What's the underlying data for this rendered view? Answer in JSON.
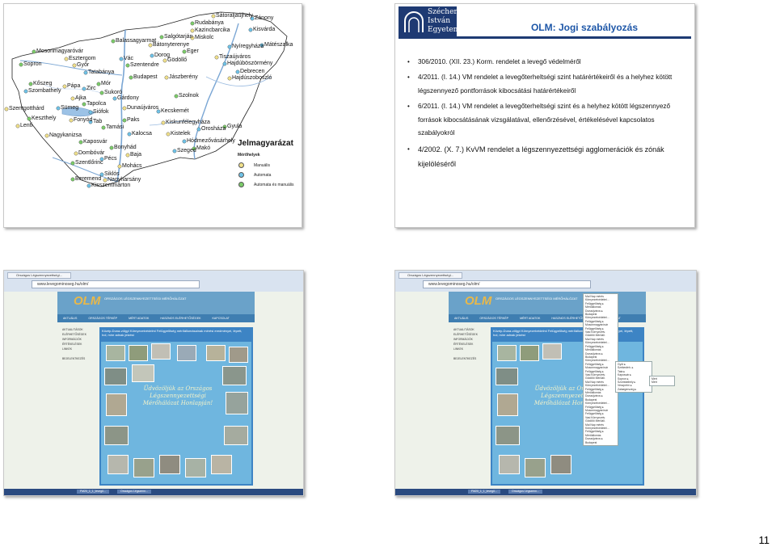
{
  "map_slide": {
    "legend_title": "Jelmagyarázat",
    "legend_subtitle": "Mérőhelyek",
    "legend": [
      {
        "label": "Manuális",
        "color": "#f0e08a"
      },
      {
        "label": "Automata",
        "color": "#6fc3e8"
      },
      {
        "label": "Automata és manuális",
        "color": "#7ccc6a"
      }
    ],
    "cities": [
      "Sátoraljaújhely",
      "Zánony",
      "Rudabánya",
      "Kazincbarcika",
      "Kisvárda",
      "Salgótarján",
      "Miskolc",
      "Mátészalka",
      "Balassagyarmat",
      "Bátonyterenye",
      "Nyíregyháza",
      "Mosonmagyaróvár",
      "Esztergom",
      "Vác",
      "Eger",
      "Tiszaújváros",
      "Dorog",
      "Szentendre",
      "Gödöllő",
      "Hajdúböszörmény",
      "Sopron",
      "Győr",
      "Tatabánya",
      "Budapest",
      "Jászberény",
      "Debrecen",
      "Kőszeg",
      "Pápa",
      "Zirc",
      "Mór",
      "Hajdúszoboszló",
      "Szombathely",
      "Sukoró",
      "Ajka",
      "Gárdony",
      "Szolnok",
      "Szentgotthárd",
      "Sümeg",
      "Tapolca",
      "Dunaújváros",
      "Kecskemét",
      "Keszthely",
      "Fonyód",
      "Siófok",
      "Paks",
      "Lenti",
      "Tab",
      "Tamási",
      "Kiskunfélegyháza",
      "Orosháza",
      "Gyula",
      "Nagykanizsa",
      "Kalocsa",
      "Kaposvár",
      "Kistelek",
      "Hódmezővásárhely",
      "Bonyhád",
      "Baja",
      "Szeged",
      "Makó",
      "Dombóvár",
      "Pécs",
      "Szentlőrinc",
      "Mohács",
      "Siklós",
      "Beremend",
      "Nagyharsány",
      "Kisszentmárton"
    ]
  },
  "text_slide": {
    "logo_lines": [
      "Széchenyi",
      "István",
      "Egyetem"
    ],
    "title": "OLM: Jogi szabályozás",
    "items": [
      "306/2010. (XII. 23.) Korm. rendelet a levegő védelméről",
      "4/2011. (I. 14.) VM rendelet a levegőterheltségi szint határértékeiről és a helyhez kötött légszennyező pontforrások kibocsátási határértékeiről",
      "6/2011. (I. 14.) VM rendelet a levegőterheltségi szint és a helyhez kötött légszennyező források kibocsátásának vizsgálatával, ellenőrzésével, értékelésével kapcsolatos szabályokról",
      "4/2002. (X. 7.) KvVM rendelet a légszennyezettségi agglomerációk és zónák kijelöléséről"
    ]
  },
  "browser": {
    "tab_label": "Országos Légszennyezettségi...",
    "url": "www.levegominoseg.hu/olm/",
    "site_logo": "OLM",
    "site_sub": "ORSZÁGOS LÉGSZENNYEZETTSÉGI MÉRŐHÁLÓZAT",
    "nav": [
      "AKTUÁLIS",
      "ORSZÁGOS TÉRKÉP",
      "MÉRT ADATOK",
      "HASZNOS ELÉRHETŐSÉGEK",
      "KAPCSOLAT"
    ],
    "side_menu": [
      "AKTUALITÁSOK",
      "ELÉRHETŐSÉGEK",
      "INFORMÁCIÓK",
      "ÉRTÉKELÉSEK",
      "LINKEK",
      "",
      "BEJELENTKEZÉS"
    ],
    "content_title": "Közép-Duna-völgyi Környezetvédelmi Felügyelőség mérőállomásainak mérési eredményei, lépett, hol, mire adnak jelzést",
    "welcome": "Üdvözöljük az Országos Légszennyezettségi Mérőhálózat Honlapján!",
    "taskbar": [
      "FM20_1_1_levegő...",
      "Országos Légszenn..."
    ],
    "dropdown": [
      "Mai Nap mérés",
      "Környezetvédelmi...",
      "Felügyelőség ▸",
      "Mérőállomás",
      "Dunaújváros ▸",
      "Budapest",
      "Környezetvédelmi...",
      "Felügyelőség ▸",
      "Mosonmagyaróvár",
      "Felügyelőség ▸",
      "Vasi Környezetv.",
      "Gödöllő Mérőáll."
    ],
    "submenu": [
      "Győr ▸",
      "Székesfeh. ▸",
      "Tata ▸",
      "Kaposvár ▸",
      "Sopron ▸",
      "Szombathely ▸",
      "Veszprém ▸",
      "Zalaegerszeg ▸"
    ],
    "submenu2": [
      "Mért",
      "Mért"
    ]
  },
  "page_number": "11"
}
